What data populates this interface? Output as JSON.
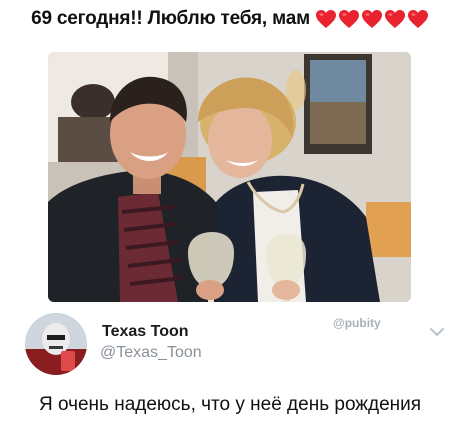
{
  "caption": {
    "text": "69 сегодня!! Люблю тебя, мам",
    "hearts": [
      "heart-icon",
      "heart-icon",
      "heart-icon",
      "heart-icon",
      "heart-icon"
    ],
    "heart_color": "#e8232f"
  },
  "photo": {
    "description_icon": "photo"
  },
  "watermark": {
    "text": "@pubity"
  },
  "profile": {
    "name": "Texas Toon",
    "handle": "@Texas_Toon",
    "menu_icon": "chevron-down-icon"
  },
  "tweet": {
    "text": "Я очень надеюсь, что у неё день рождения"
  }
}
